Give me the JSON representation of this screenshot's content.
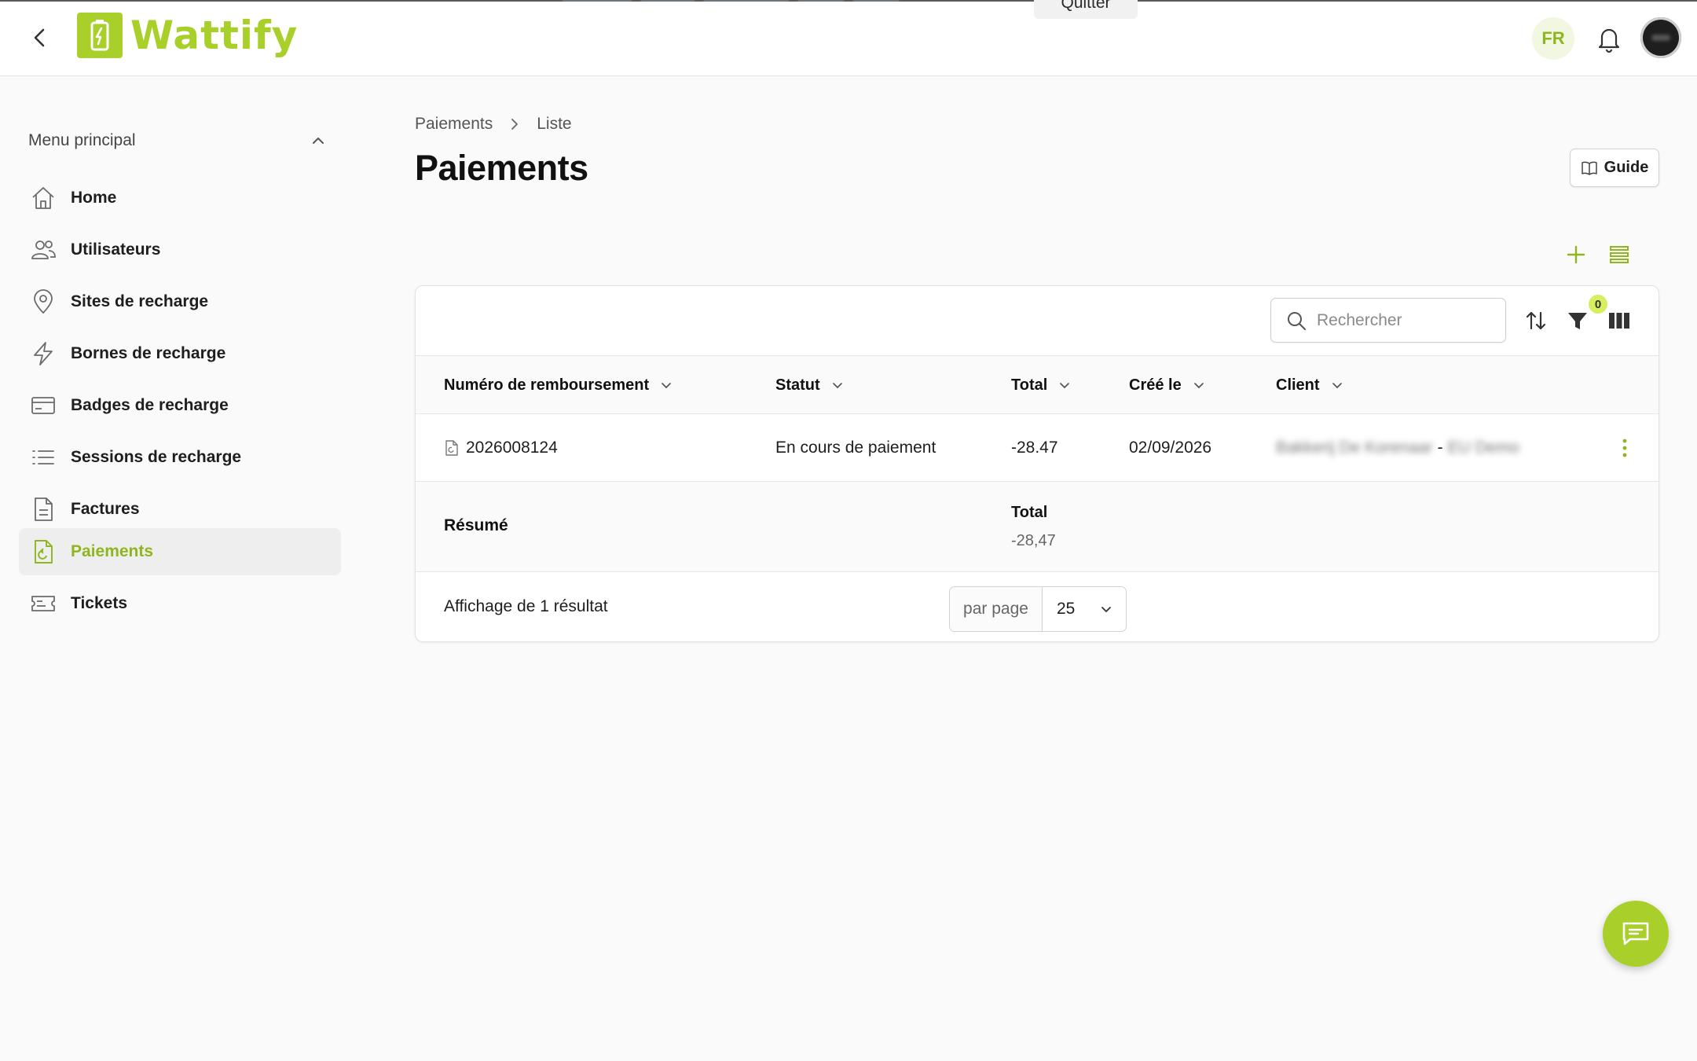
{
  "header": {
    "app_name": "Wattify",
    "quit_label": "Quitter",
    "language": "FR"
  },
  "sidebar": {
    "section_title": "Menu principal",
    "items": [
      {
        "label": "Home",
        "icon": "home-icon"
      },
      {
        "label": "Utilisateurs",
        "icon": "users-icon"
      },
      {
        "label": "Sites de recharge",
        "icon": "map-pin-icon"
      },
      {
        "label": "Bornes de recharge",
        "icon": "bolt-icon"
      },
      {
        "label": "Badges de recharge",
        "icon": "card-icon"
      },
      {
        "label": "Sessions de recharge",
        "icon": "list-icon"
      },
      {
        "label": "Factures",
        "icon": "document-icon"
      },
      {
        "label": "Paiements",
        "icon": "refund-icon",
        "active": true
      },
      {
        "label": "Tickets",
        "icon": "ticket-icon"
      }
    ]
  },
  "breadcrumb": {
    "items": [
      "Paiements",
      "Liste"
    ]
  },
  "page": {
    "title": "Paiements",
    "guide_label": "Guide"
  },
  "toolbar": {
    "search_placeholder": "Rechercher",
    "filter_count": "0"
  },
  "table": {
    "columns": [
      "Numéro de remboursement",
      "Statut",
      "Total",
      "Créé le",
      "Client"
    ],
    "rows": [
      {
        "number": "2026008124",
        "status": "En cours de paiement",
        "total": "-28.47",
        "created": "02/09/2026",
        "client_name": "Bakkerij De Korenaar",
        "client_sep": "-",
        "client_company": "EU Demo"
      }
    ],
    "summary": {
      "label": "Résumé",
      "total_label": "Total",
      "total_value": "-28,47"
    },
    "footer": {
      "result_text": "Affichage de 1 résultat",
      "per_page_label": "par page",
      "per_page_value": "25"
    }
  },
  "colors": {
    "accent": "#a8cf2a",
    "accent_text": "#8fb51f"
  }
}
